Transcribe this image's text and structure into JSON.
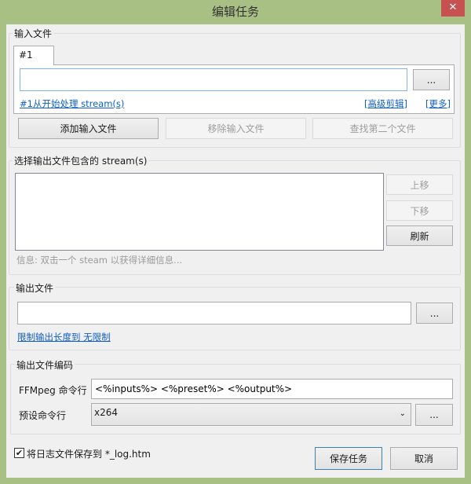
{
  "window": {
    "title": "编辑任务",
    "close": "✕"
  },
  "input_group": {
    "label": "输入文件",
    "tab": "#1",
    "file_value": "",
    "browse": "...",
    "link_streams": "#1从开始处理 stream(s)",
    "link_advanced": "[高级剪辑]",
    "link_more": "[更多]",
    "add": "添加输入文件",
    "remove": "移除输入文件",
    "find_second": "查找第二个文件"
  },
  "stream_group": {
    "label": "选择输出文件包含的 stream(s)",
    "up": "上移",
    "down": "下移",
    "refresh": "刷新",
    "info": "信息: 双击一个 steam 以获得详细信息..."
  },
  "output_group": {
    "label": "输出文件",
    "file_value": "",
    "browse": "...",
    "limit_link": "限制输出长度到 无限制"
  },
  "encoding_group": {
    "label": "输出文件编码",
    "ffmpeg_label": "FFMpeg 命令行",
    "ffmpeg_value": "<%inputs%> <%preset%> <%output%>",
    "preset_label": "预设命令行",
    "preset_value": "x264",
    "preset_browse": "..."
  },
  "footer": {
    "save_log_label": "将日志文件保存到 *_log.htm",
    "save_log_checked": true,
    "save": "保存任务",
    "cancel": "取消"
  }
}
